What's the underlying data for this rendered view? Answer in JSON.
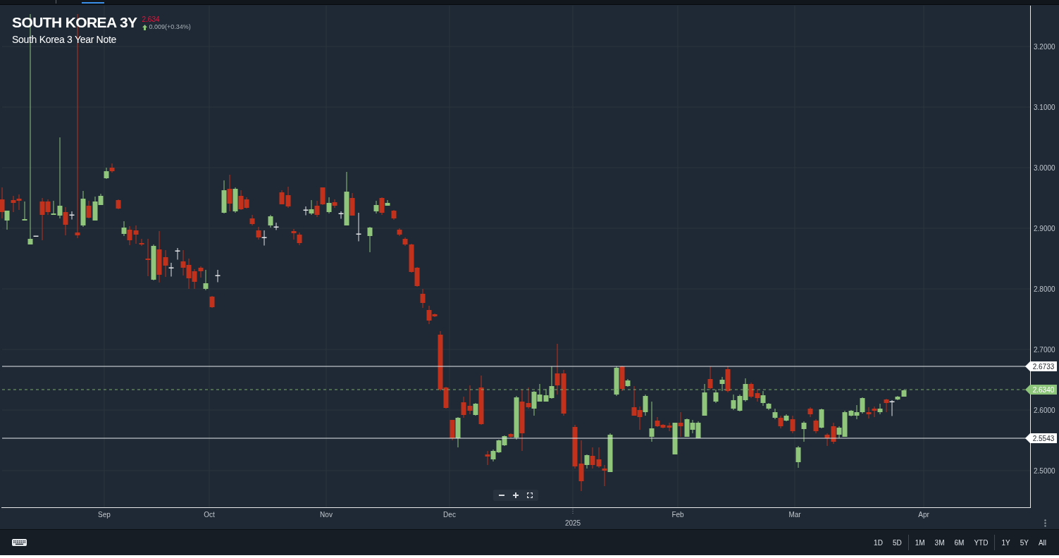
{
  "header": {
    "title": "SOUTH KOREA 3Y",
    "price": "2.634",
    "price_ticked_down": true,
    "change": "0.009(+0.34%)",
    "change_up": true,
    "subtitle": "South Korea 3 Year Note"
  },
  "chart": {
    "y_axis_labels": [
      "3.2000",
      "3.1000",
      "3.0000",
      "2.9000",
      "2.8000",
      "2.7000",
      "2.6000",
      "2.5000"
    ],
    "x_axis_labels": [
      {
        "label": "Sep",
        "kind": "month"
      },
      {
        "label": "Oct",
        "kind": "month"
      },
      {
        "label": "Nov",
        "kind": "month"
      },
      {
        "label": "Dec",
        "kind": "month"
      },
      {
        "label": "2025",
        "kind": "year"
      },
      {
        "label": "Feb",
        "kind": "month"
      },
      {
        "label": "Mar",
        "kind": "month"
      },
      {
        "label": "Apr",
        "kind": "month"
      }
    ],
    "price_lines": [
      {
        "kind": "drawn",
        "label": "2.6733"
      },
      {
        "kind": "last",
        "label": "2.6340"
      },
      {
        "kind": "drawn",
        "label": "2.5543"
      }
    ]
  },
  "range_buttons": [
    [
      {
        "label": "1D",
        "selected": false
      },
      {
        "label": "5D",
        "selected": false
      }
    ],
    [
      {
        "label": "1M",
        "selected": false
      },
      {
        "label": "3M",
        "selected": false
      },
      {
        "label": "6M",
        "selected": false
      },
      {
        "label": "YTD",
        "selected": false
      }
    ],
    [
      {
        "label": "1Y",
        "selected": false
      },
      {
        "label": "5Y",
        "selected": false
      },
      {
        "label": "All",
        "selected": false
      }
    ]
  ]
}
